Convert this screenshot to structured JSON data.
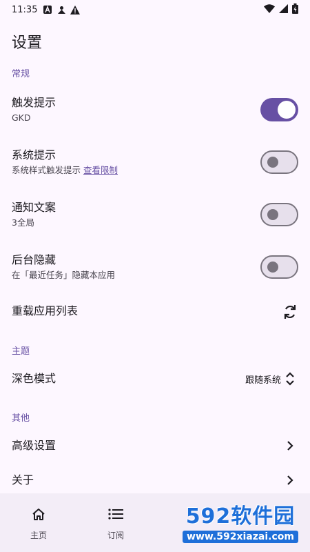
{
  "status_bar": {
    "time": "11:35"
  },
  "page": {
    "title": "设置"
  },
  "sections": {
    "general": "常规",
    "theme": "主题",
    "other": "其他"
  },
  "settings": {
    "trigger_tip": {
      "title": "触发提示",
      "desc": "GKD",
      "enabled": true
    },
    "system_tip": {
      "title": "系统提示",
      "desc": "系统样式触发提示",
      "link": "查看限制",
      "enabled": false
    },
    "notify_text": {
      "title": "通知文案",
      "desc": "3全局",
      "enabled": false
    },
    "background_hide": {
      "title": "后台隐藏",
      "desc": "在「最近任务」隐藏本应用",
      "enabled": false
    },
    "reload_apps": {
      "title": "重载应用列表"
    },
    "dark_mode": {
      "title": "深色模式",
      "value": "跟随系统"
    },
    "advanced": {
      "title": "高级设置"
    },
    "about": {
      "title": "关于"
    }
  },
  "bottom_nav": {
    "home": "主页",
    "subscribe": "订阅"
  },
  "watermark": {
    "brand": "592软件园",
    "url": "www.592xiazai.com"
  },
  "colors": {
    "accent": "#6750a4",
    "background": "#fdf7ff",
    "nav_background": "#f3edf7"
  }
}
